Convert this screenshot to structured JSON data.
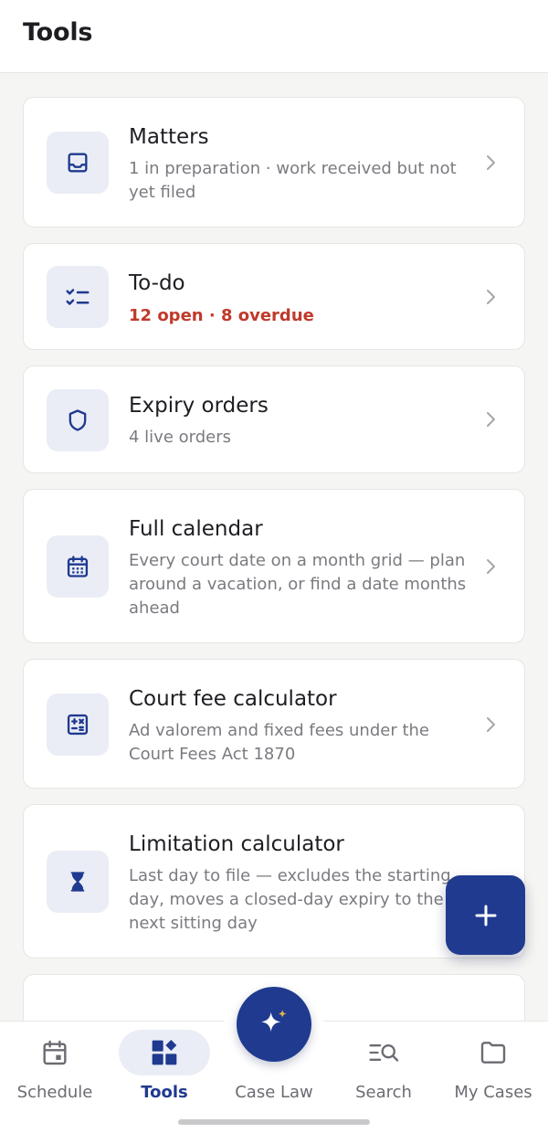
{
  "header": {
    "title": "Tools"
  },
  "cards": [
    {
      "title": "Matters",
      "subtitle": "1 in preparation · work received but not yet filed",
      "icon": "inbox-icon"
    },
    {
      "title": "To-do",
      "subtitle": "12 open · 8 overdue",
      "icon": "checklist-icon",
      "subtitle_color": "#c0392b"
    },
    {
      "title": "Expiry orders",
      "subtitle": "4 live orders",
      "icon": "shield-icon"
    },
    {
      "title": "Full calendar",
      "subtitle": "Every court date on a month grid — plan around a vacation, or find a date months ahead",
      "icon": "calendar-icon"
    },
    {
      "title": "Court fee calculator",
      "subtitle": "Ad valorem and fixed fees under the Court Fees Act 1870",
      "icon": "calculator-icon"
    },
    {
      "title": "Limitation calculator",
      "subtitle": "Last day to file — excludes the starting day, moves a closed-day expiry to the next sitting day",
      "icon": "hourglass-icon"
    }
  ],
  "fab": {
    "icon": "plus-icon"
  },
  "nav": {
    "items": [
      {
        "label": "Schedule",
        "icon": "calendar-icon"
      },
      {
        "label": "Tools",
        "icon": "tools-grid-icon",
        "active": true
      },
      {
        "label": "Case Law",
        "icon": "sparkle-icon"
      },
      {
        "label": "Search",
        "icon": "list-search-icon"
      },
      {
        "label": "My Cases",
        "icon": "folder-icon"
      }
    ]
  },
  "colors": {
    "accent": "#1f3a8f",
    "alert": "#c0392b",
    "icon_bg": "#eaedf5",
    "sparkle_gold": "#e3b341"
  }
}
